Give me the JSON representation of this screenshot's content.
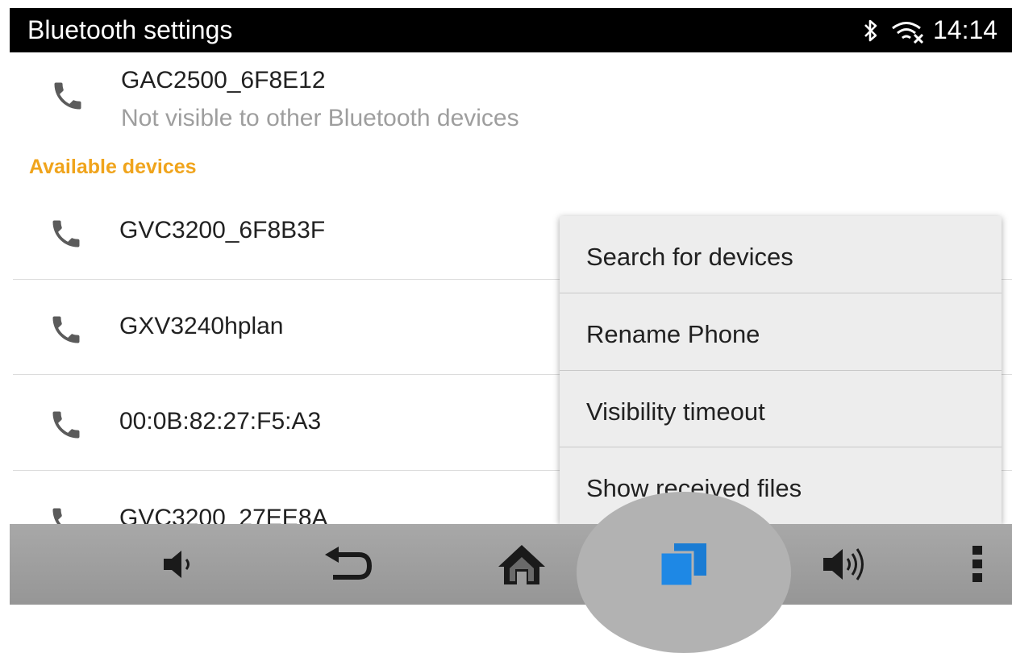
{
  "status_bar": {
    "title": "Bluetooth settings",
    "time": "14:14",
    "icons": [
      "bluetooth-icon",
      "wifi-no-internet-icon"
    ]
  },
  "own_device": {
    "name": "GAC2500_6F8E12",
    "status": "Not visible to other Bluetooth devices",
    "icon": "phone-icon"
  },
  "available_section": {
    "header": "Available devices",
    "devices": [
      {
        "label": "GVC3200_6F8B3F",
        "icon": "phone-icon"
      },
      {
        "label": "GXV3240hplan",
        "icon": "phone-icon"
      },
      {
        "label": "00:0B:82:27:F5:A3",
        "icon": "phone-icon"
      },
      {
        "label": "GVC3200_27EE8A",
        "icon": "phone-icon"
      }
    ]
  },
  "overflow_menu": {
    "items": [
      {
        "label": "Search for devices"
      },
      {
        "label": "Rename Phone"
      },
      {
        "label": "Visibility timeout"
      },
      {
        "label": "Show received files"
      }
    ]
  },
  "nav_bar": {
    "buttons": [
      "volume-down-icon",
      "back-icon",
      "home-icon",
      "recent-apps-icon",
      "volume-up-icon",
      "more-options-icon"
    ],
    "active": "recent-apps-icon"
  },
  "colors": {
    "accent": "#f0a41c",
    "status_bar": "#000000",
    "nav_bar": "#a0a0a0",
    "recent_apps_icon": "#1e7fd0",
    "icon_gray": "#5b5b5b"
  }
}
